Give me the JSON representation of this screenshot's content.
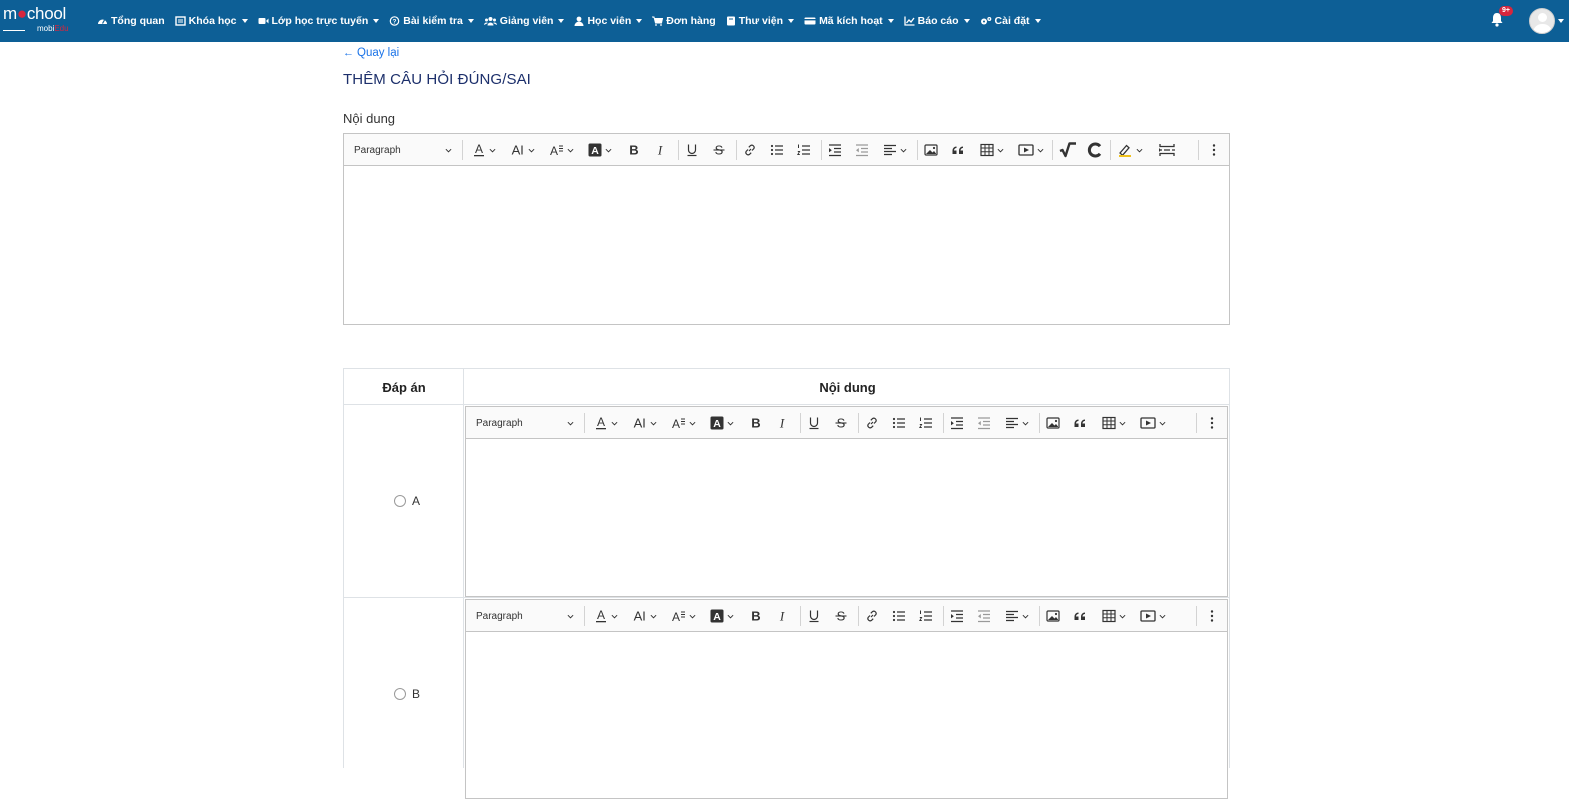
{
  "app": {
    "logo_main": "m",
    "logo_main_rest": "chool",
    "logo_sub": "mobi",
    "logo_sub_accent": "Edu",
    "notification_count": "9+"
  },
  "nav": {
    "items": [
      {
        "label": "Tổng quan",
        "icon": "dashboard-icon",
        "dropdown": false
      },
      {
        "label": "Khóa học",
        "icon": "book-icon",
        "dropdown": true
      },
      {
        "label": "Lớp học trực tuyến",
        "icon": "video-icon",
        "dropdown": true
      },
      {
        "label": "Bài kiểm tra",
        "icon": "question-circle-icon",
        "dropdown": true
      },
      {
        "label": "Giảng viên",
        "icon": "users-icon",
        "dropdown": true
      },
      {
        "label": "Học viên",
        "icon": "user-icon",
        "dropdown": true
      },
      {
        "label": "Đơn hàng",
        "icon": "cart-icon",
        "dropdown": false
      },
      {
        "label": "Thư viện",
        "icon": "library-icon",
        "dropdown": true
      },
      {
        "label": "Mã kích hoạt",
        "icon": "card-icon",
        "dropdown": true
      },
      {
        "label": "Báo cáo",
        "icon": "chart-icon",
        "dropdown": true
      },
      {
        "label": "Cài đặt",
        "icon": "cogs-icon",
        "dropdown": true
      }
    ]
  },
  "page": {
    "back_label": "Quay lại",
    "title": "THÊM CÂU HỎI ĐÚNG/SAI",
    "content_label": "Nội dung"
  },
  "editor": {
    "paragraph": "Paragraph"
  },
  "table": {
    "col_answer": "Đáp án",
    "col_content": "Nội dung",
    "rows": [
      {
        "label": "A"
      },
      {
        "label": "B"
      }
    ]
  },
  "colors": {
    "navbar": "#0d5f96",
    "link": "#1a73e8",
    "title": "#1c2f6b",
    "badge": "#d7263d"
  }
}
